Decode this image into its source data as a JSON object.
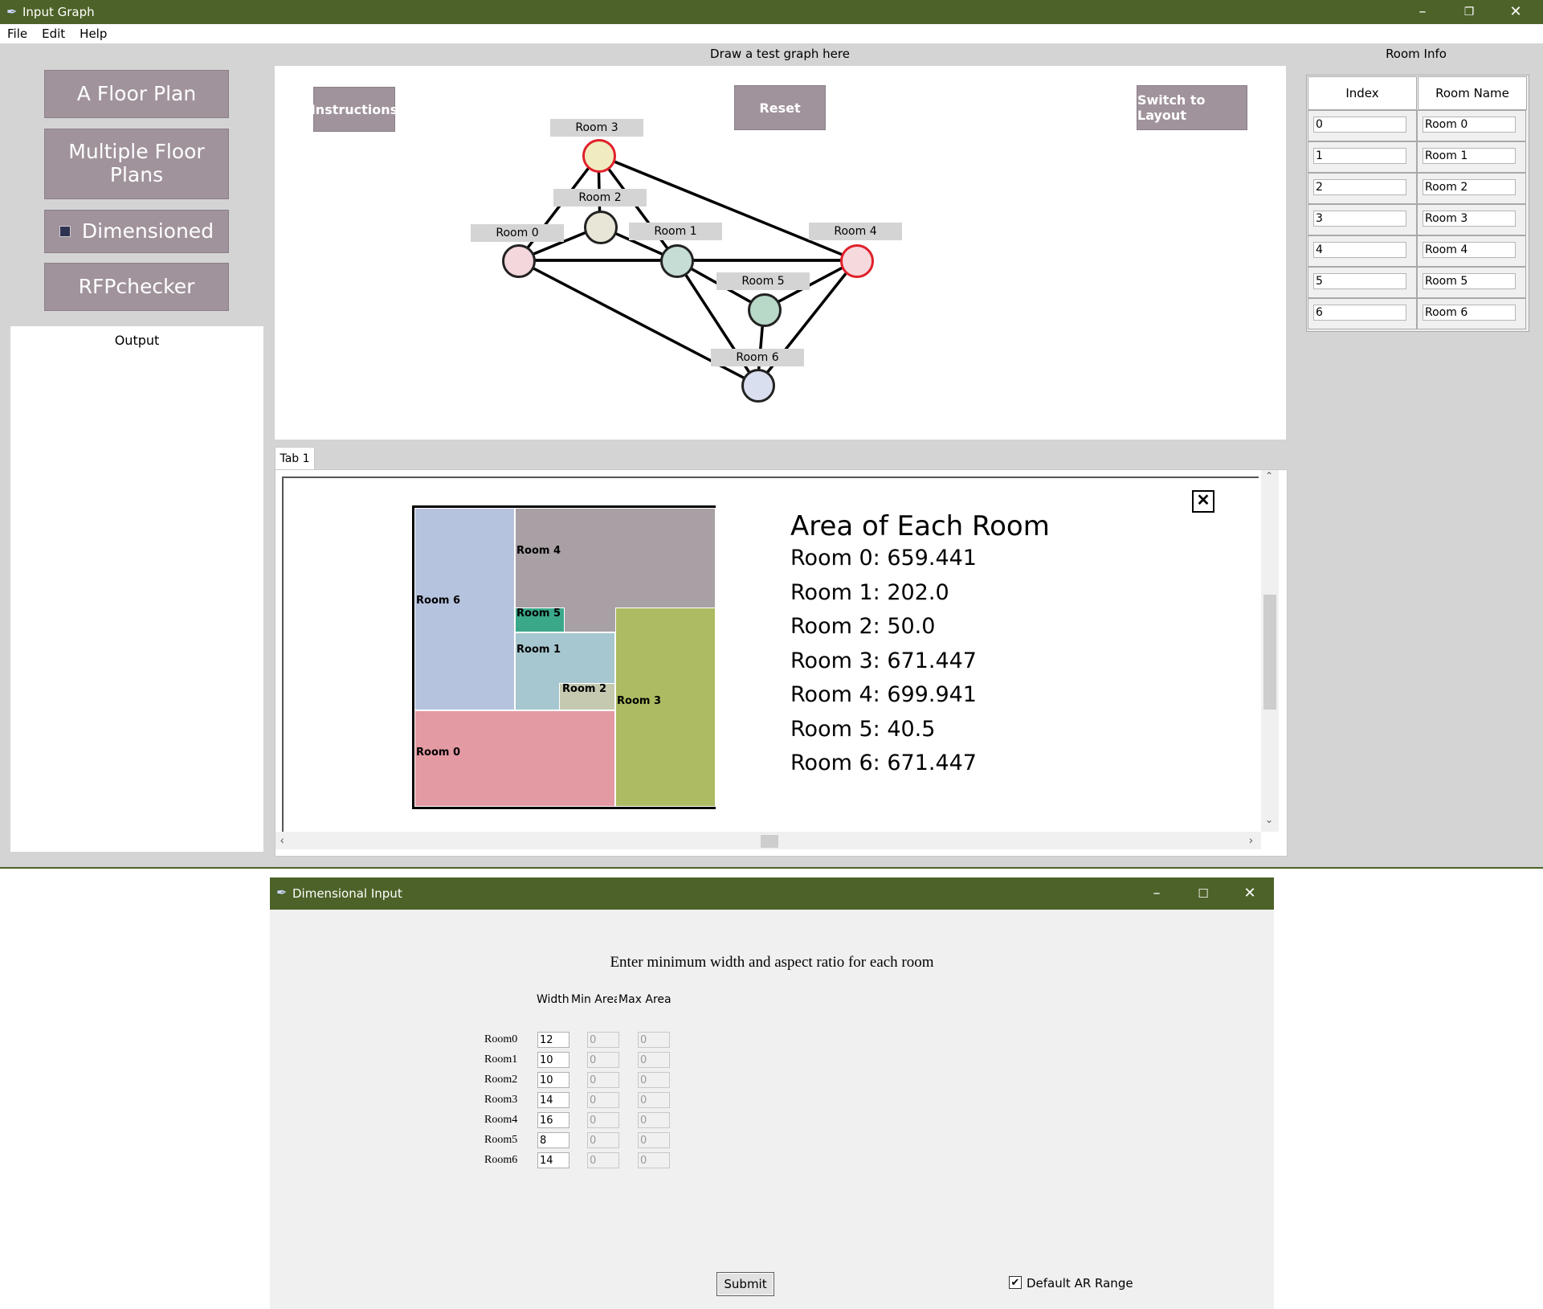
{
  "main_window": {
    "title": "Input Graph",
    "menu": [
      "File",
      "Edit",
      "Help"
    ],
    "left_panel": {
      "buttons": [
        "A Floor Plan",
        "Multiple Floor Plans",
        "Dimensioned",
        "RFPchecker"
      ],
      "output_label": "Output"
    },
    "canvas": {
      "caption": "Draw a test graph here",
      "instructions_label": "Instructions",
      "reset_label": "Reset",
      "switch_label": "Switch to Layout",
      "nodes": [
        {
          "label": "Room 0",
          "fill": "#f3d7dc",
          "stroke": "#222"
        },
        {
          "label": "Room 1",
          "fill": "#c5ddd5",
          "stroke": "#222"
        },
        {
          "label": "Room 2",
          "fill": "#e8e6d6",
          "stroke": "#222"
        },
        {
          "label": "Room 3",
          "fill": "#f0ecc0",
          "stroke": "#e0202a"
        },
        {
          "label": "Room 4",
          "fill": "#f6d9dd",
          "stroke": "#e0202a"
        },
        {
          "label": "Room 5",
          "fill": "#b8d8c8",
          "stroke": "#222"
        },
        {
          "label": "Room 6",
          "fill": "#dadff0",
          "stroke": "#222"
        }
      ]
    },
    "room_info": {
      "caption": "Room Info",
      "headers": [
        "Index",
        "Room Name"
      ],
      "rows": [
        {
          "index": "0",
          "name": "Room 0"
        },
        {
          "index": "1",
          "name": "Room 1"
        },
        {
          "index": "2",
          "name": "Room 2"
        },
        {
          "index": "3",
          "name": "Room 3"
        },
        {
          "index": "4",
          "name": "Room 4"
        },
        {
          "index": "5",
          "name": "Room 5"
        },
        {
          "index": "6",
          "name": "Room 6"
        }
      ]
    },
    "tab": {
      "label": "Tab 1",
      "floor_plan_rooms": [
        {
          "label": "Room 6",
          "color": "#b6c3de"
        },
        {
          "label": "Room 4",
          "color": "#a8a0a4"
        },
        {
          "label": "Room 5",
          "color": "#3ba88a"
        },
        {
          "label": "Room 1",
          "color": "#a6c7cf"
        },
        {
          "label": "Room 2",
          "color": "#c5c9b0"
        },
        {
          "label": "Room 3",
          "color": "#adbb62"
        },
        {
          "label": "Room 0",
          "color": "#e49aa3"
        }
      ],
      "area_title": "Area of Each Room",
      "areas": [
        "Room 0: 659.441",
        "Room 1: 202.0",
        "Room 2: 50.0",
        "Room 3: 671.447",
        "Room 4: 699.941",
        "Room 5: 40.5",
        "Room 6: 671.447"
      ]
    }
  },
  "dimensional_dialog": {
    "title": "Dimensional Input",
    "instruction": "Enter minimum width and aspect ratio for each room",
    "column_headers": [
      "Width",
      "Min Area",
      "Max Area"
    ],
    "rows": [
      {
        "label": "Room0",
        "width": "12",
        "min_area": "0",
        "max_area": "0"
      },
      {
        "label": "Room1",
        "width": "10",
        "min_area": "0",
        "max_area": "0"
      },
      {
        "label": "Room2",
        "width": "10",
        "min_area": "0",
        "max_area": "0"
      },
      {
        "label": "Room3",
        "width": "14",
        "min_area": "0",
        "max_area": "0"
      },
      {
        "label": "Room4",
        "width": "16",
        "min_area": "0",
        "max_area": "0"
      },
      {
        "label": "Room5",
        "width": "8",
        "min_area": "0",
        "max_area": "0"
      },
      {
        "label": "Room6",
        "width": "14",
        "min_area": "0",
        "max_area": "0"
      }
    ],
    "submit_label": "Submit",
    "default_ar_label": "Default AR Range",
    "default_ar_checked": true
  }
}
